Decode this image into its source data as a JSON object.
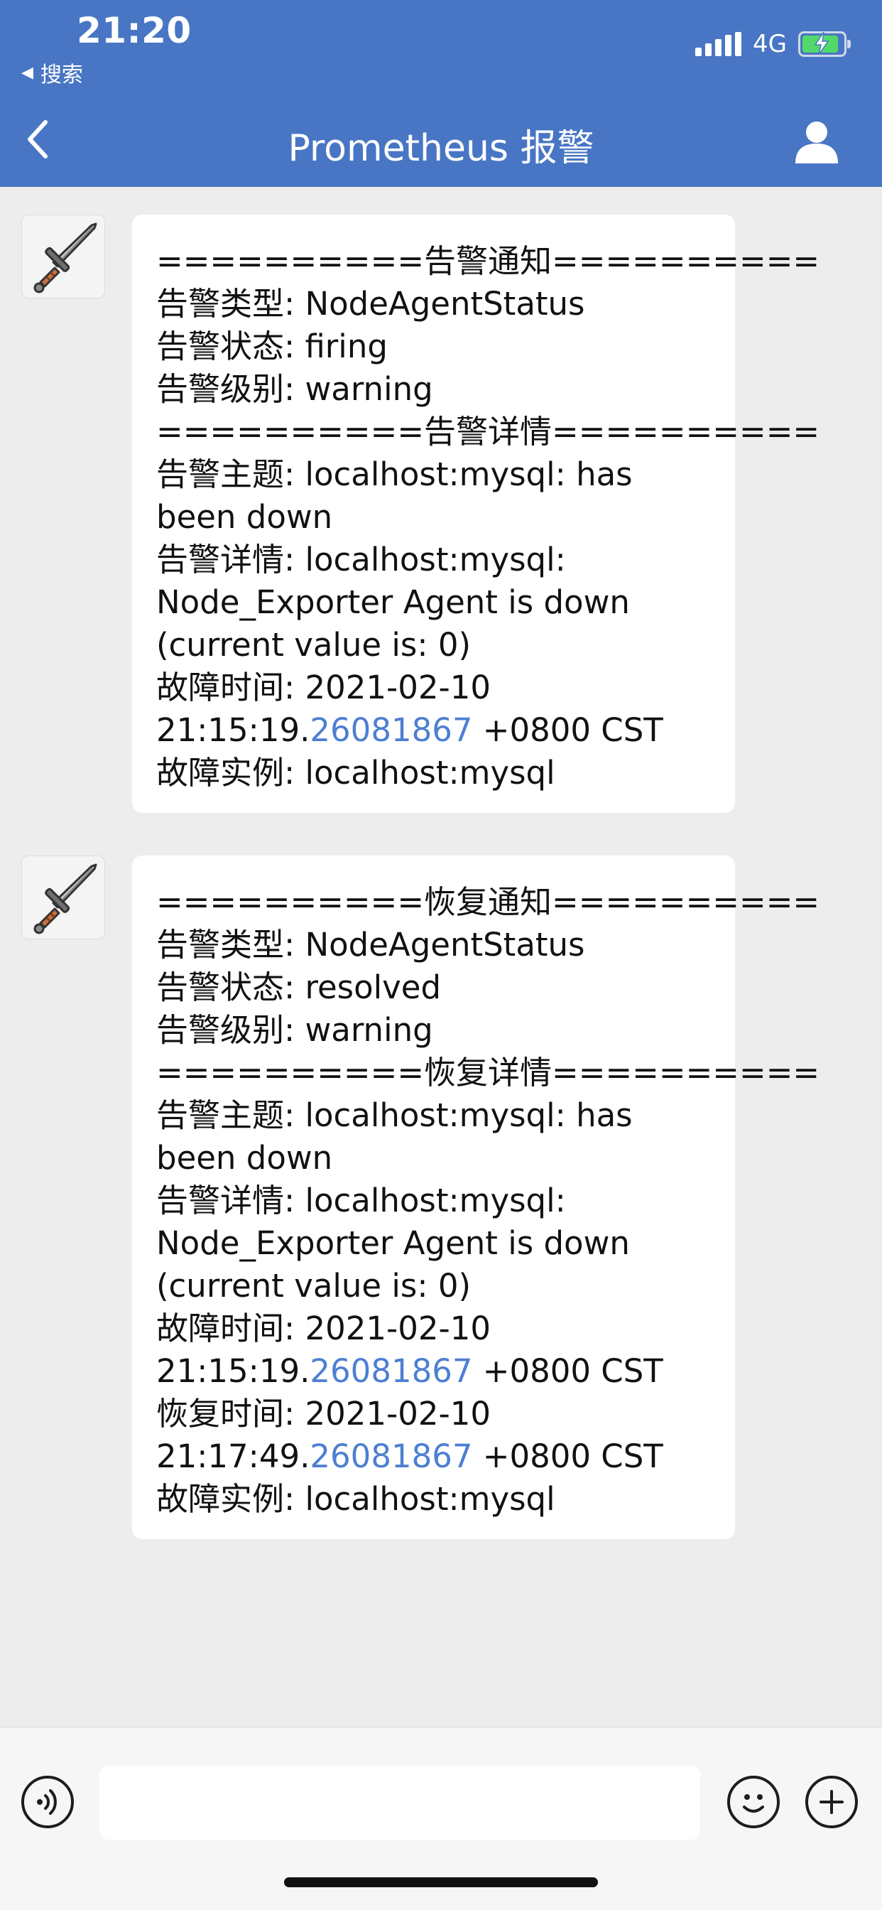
{
  "status_bar": {
    "time": "21:20",
    "back_app_label": "搜索",
    "network": "4G"
  },
  "nav": {
    "title": "Prometheus 报警"
  },
  "messages": [
    {
      "sender_icon": "sword-icon",
      "lines": [
        "==========告警通知==========",
        "告警类型: NodeAgentStatus",
        "告警状态: firing",
        "告警级别: warning",
        "==========告警详情==========",
        "告警主题: localhost:mysql: has been down",
        "告警详情: localhost:mysql: Node_Exporter Agent is down (current value is: 0)"
      ],
      "fault_time_label": "故障时间: 2021-02-10",
      "fault_time_prefix": "21:15:19.",
      "fault_time_link": "26081867",
      "fault_time_suffix": " +0800 CST",
      "instance": "故障实例: localhost:mysql"
    },
    {
      "sender_icon": "sword-icon",
      "lines": [
        "==========恢复通知==========",
        "告警类型: NodeAgentStatus",
        "告警状态: resolved",
        "告警级别: warning",
        "==========恢复详情==========",
        "告警主题: localhost:mysql: has been down",
        "告警详情: localhost:mysql: Node_Exporter Agent is down (current value is: 0)"
      ],
      "fault_time_label": "故障时间: 2021-02-10",
      "fault_time_prefix": "21:15:19.",
      "fault_time_link": "26081867",
      "fault_time_suffix": " +0800 CST",
      "recover_time_label": "恢复时间: 2021-02-10",
      "recover_time_prefix": "21:17:49.",
      "recover_time_link": "26081867",
      "recover_time_suffix": " +0800 CST",
      "instance": "故障实例: localhost:mysql"
    }
  ],
  "input_bar": {
    "placeholder": "",
    "icons": [
      "voice-icon",
      "emoji-icon",
      "plus-icon"
    ]
  },
  "colors": {
    "header": "#4876c4",
    "link": "#4d7fd2",
    "background": "#ededed"
  }
}
